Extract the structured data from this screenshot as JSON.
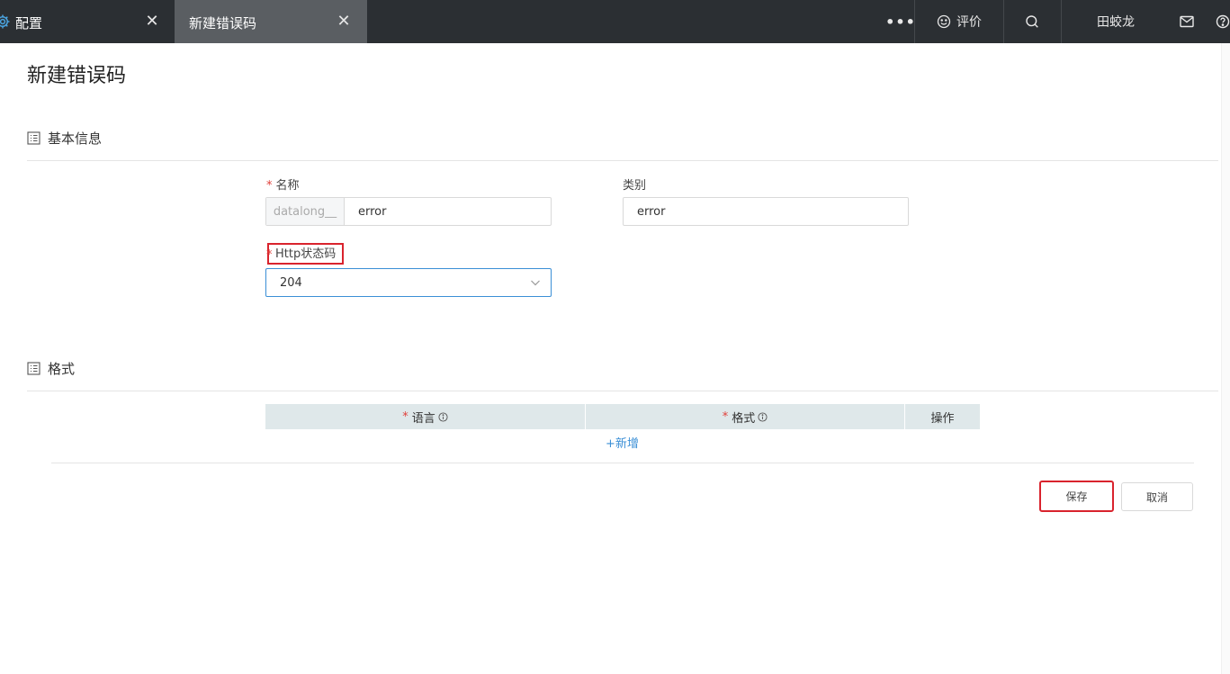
{
  "tabs": [
    {
      "label": "配置",
      "icon": "gear-icon"
    },
    {
      "label": "新建错误码",
      "active": true
    }
  ],
  "topbar": {
    "more": "•••",
    "rate_label": "评价",
    "user_name": "田蛟龙"
  },
  "page": {
    "title": "新建错误码"
  },
  "basic_info": {
    "heading": "基本信息",
    "name": {
      "label": "名称",
      "required": true,
      "prefix": "datalong__",
      "value": "error"
    },
    "type": {
      "label": "类别",
      "value": "error"
    },
    "http_status": {
      "label": "Http状态码",
      "required": true,
      "value": "204"
    }
  },
  "format": {
    "heading": "格式",
    "columns": [
      {
        "label": "语言",
        "required": true
      },
      {
        "label": "格式",
        "required": true
      },
      {
        "label": "操作"
      }
    ],
    "add_label": "+新增"
  },
  "actions": {
    "save": "保存",
    "cancel": "取消"
  },
  "colors": {
    "topbar_bg": "#2b2f33",
    "active_tab_bg": "#5a5e62",
    "accent": "#3b8fd6",
    "required": "#e0403a",
    "highlight_box": "#d9232d",
    "table_header_bg": "#dfe8ea"
  }
}
